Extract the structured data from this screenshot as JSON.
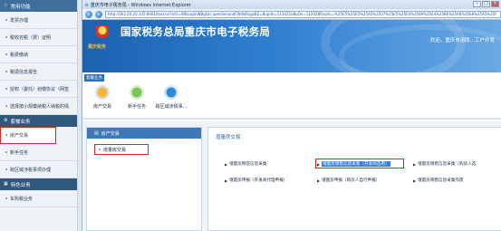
{
  "sidebar": {
    "section1": "常用功能",
    "items1": [
      "发票办理",
      "税收完税（费）证明",
      "税费缴纳",
      "税源信息报告",
      "授权（委托）划缴协议（网签",
      "选择按小规模纳税人纳税的情"
    ],
    "section2": "套餐业务",
    "items2": [
      "房产交易",
      "新手任务",
      "跨区域涉税事项办理"
    ],
    "section3": "特色业务",
    "items3": [
      "车购税业务"
    ]
  },
  "ie": {
    "title": "重庆市电子税务局 - Windows Internet Explorer",
    "url": "http://162.20.20.105:8081/taxsrv/?sfct=WBLoginWBgLbl_openSecondFWdWGgjzBZ=8updn=1110Z1b8pDn=1120Z8Rxptlc=%25E5%25E5%25A5%2507%25E5%25E4%2589%25E4%258E%25A6%25E8%25A5%25F"
  },
  "banner": {
    "title": "国家税务总局重庆市电子税务局",
    "sub": "重庆税务",
    "welcome": "欢迎，重庆市涪陵...工户开发"
  },
  "features": {
    "tag": "套餐业务",
    "items": [
      "房产交易",
      "新手任务",
      "跨区域涉税事..."
    ]
  },
  "content": {
    "sublist_head": "房产交易",
    "sublist_item": "增量房交易",
    "panel_title": "增量房交易",
    "links": [
      "增量房网签信息采集",
      "增量房销售信息采集（开发商选用）",
      "增量房销售信息采集（购房人选",
      "增量房申报（开发商代理申报）",
      "增量房申报（购房人自行申报）",
      "增量房销售信息采集作废"
    ]
  }
}
